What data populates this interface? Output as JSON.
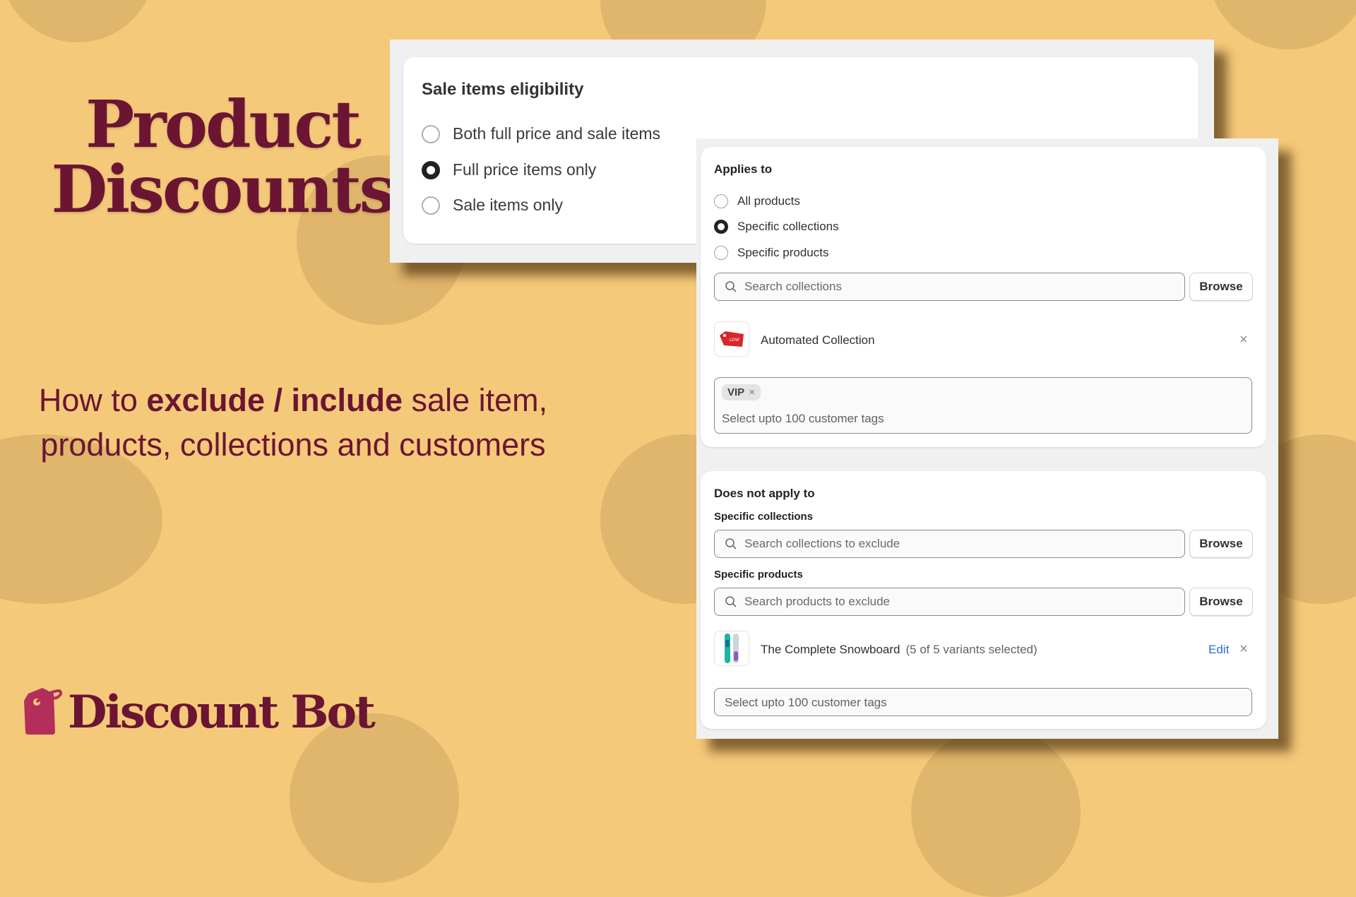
{
  "hero": {
    "title_line1": "Product",
    "title_line2": "Discounts",
    "subtitle_prefix": "How to ",
    "subtitle_bold": "exclude / include",
    "subtitle_suffix": " sale item, products, collections and customers"
  },
  "brand": {
    "name": "Discount Bot",
    "icon": "price-tag-icon",
    "color": "#b32e5a"
  },
  "colors": {
    "background": "#f5c97a",
    "circle": "#e0b66c",
    "text_primary": "#6b1533",
    "link": "#2c6ecb"
  },
  "sale_eligibility": {
    "title": "Sale items eligibility",
    "options": [
      {
        "label": "Both full price and sale items",
        "selected": false
      },
      {
        "label": "Full price items only",
        "selected": true
      },
      {
        "label": "Sale items only",
        "selected": false
      }
    ]
  },
  "applies_to": {
    "title": "Applies to",
    "options": [
      {
        "label": "All products",
        "selected": false
      },
      {
        "label": "Specific collections",
        "selected": true
      },
      {
        "label": "Specific products",
        "selected": false
      }
    ],
    "search_placeholder": "Search collections",
    "browse_label": "Browse",
    "selected_items": [
      {
        "name": "Automated Collection",
        "thumbnail": "sale-tag-image"
      }
    ],
    "customer_tags": {
      "chips": [
        "VIP"
      ],
      "placeholder": "Select upto 100 customer tags"
    }
  },
  "does_not_apply_to": {
    "title": "Does not apply to",
    "collections": {
      "label": "Specific collections",
      "search_placeholder": "Search collections to exclude",
      "browse_label": "Browse"
    },
    "products": {
      "label": "Specific products",
      "search_placeholder": "Search products to exclude",
      "browse_label": "Browse",
      "selected_items": [
        {
          "name": "The Complete Snowboard",
          "meta": "(5 of 5 variants selected)",
          "edit_label": "Edit",
          "thumbnail": "snowboard-image"
        }
      ]
    },
    "customer_tags": {
      "placeholder": "Select upto 100 customer tags"
    }
  }
}
